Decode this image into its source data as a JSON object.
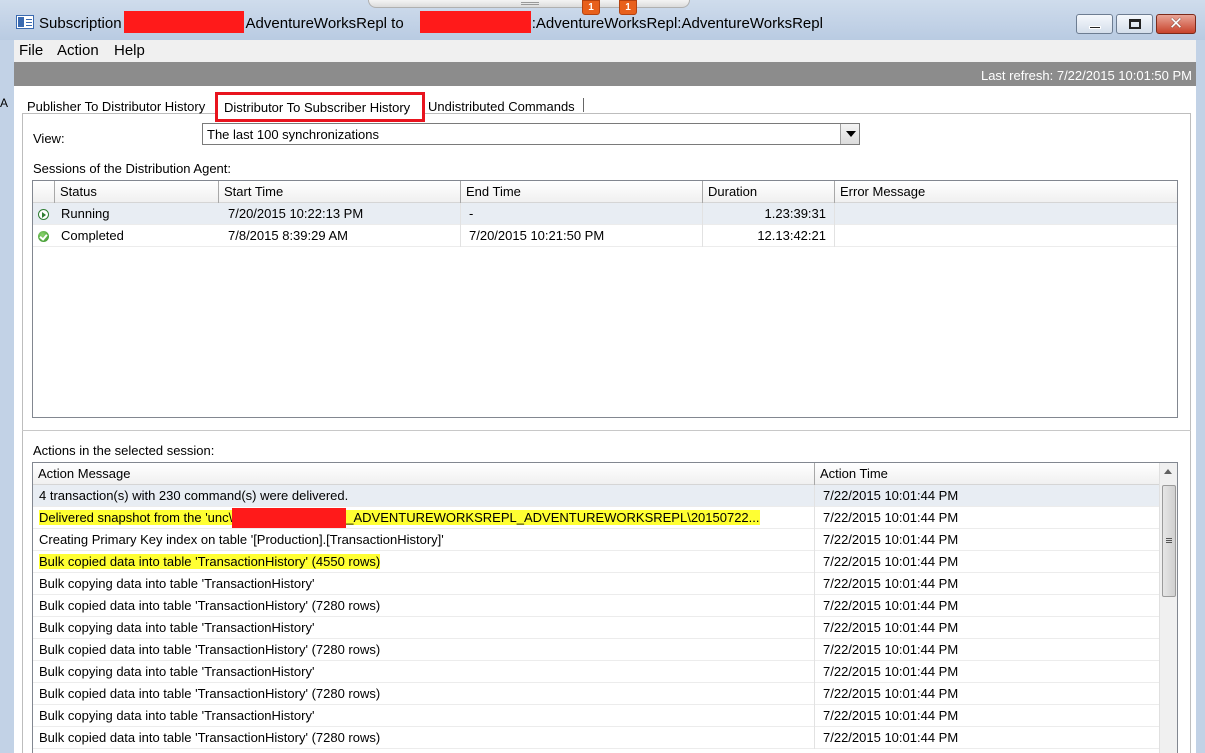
{
  "window": {
    "title_prefix": "Subscription",
    "title_middle": "AdventureWorksRepl to",
    "title_suffix": ":AdventureWorksRepl:AdventureWorksRepl",
    "notifications": [
      "1",
      "1"
    ],
    "close_glyph": "✕",
    "left_edge_mark": "A"
  },
  "menu": {
    "items": [
      "File",
      "Action",
      "Help"
    ]
  },
  "refresh": {
    "text": "Last refresh: 7/22/2015 10:01:50 PM"
  },
  "tabs": {
    "items": [
      "Publisher To Distributor History",
      "Distributor To Subscriber History",
      "Undistributed Commands"
    ],
    "active_index": 1
  },
  "view": {
    "label": "View:",
    "selected": "The last 100 synchronizations"
  },
  "sessions": {
    "label": "Sessions of the Distribution Agent:",
    "columns": [
      "Status",
      "Start Time",
      "End Time",
      "Duration",
      "Error Message"
    ],
    "rows": [
      {
        "status_icon": "running-icon",
        "status": "Running",
        "start": "7/20/2015 10:22:13 PM",
        "end": "-",
        "duration": "1.23:39:31",
        "error": ""
      },
      {
        "status_icon": "completed-icon",
        "status": "Completed",
        "start": "7/8/2015 8:39:29 AM",
        "end": "7/20/2015 10:21:50 PM",
        "duration": "12.13:42:21",
        "error": ""
      }
    ]
  },
  "actions": {
    "label": "Actions in the selected session:",
    "columns": [
      "Action Message",
      "Action Time"
    ],
    "snapshot_prefix": "Delivered snapshot from the 'unc\\",
    "snapshot_suffix": "_ADVENTUREWORKSREPL_ADVENTUREWORKSREPL\\20150722...",
    "rows": [
      {
        "message": "4 transaction(s) with 230 command(s) were delivered.",
        "time": "7/22/2015 10:01:44 PM"
      },
      {
        "message": "",
        "time": "7/22/2015 10:01:44 PM"
      },
      {
        "message": "Creating Primary Key index on table '[Production].[TransactionHistory]'",
        "time": "7/22/2015 10:01:44 PM"
      },
      {
        "message": "Bulk copied data into table 'TransactionHistory' (4550 rows)",
        "time": "7/22/2015 10:01:44 PM"
      },
      {
        "message": "Bulk copying data into table 'TransactionHistory'",
        "time": "7/22/2015 10:01:44 PM"
      },
      {
        "message": "Bulk copied data into table 'TransactionHistory' (7280 rows)",
        "time": "7/22/2015 10:01:44 PM"
      },
      {
        "message": "Bulk copying data into table 'TransactionHistory'",
        "time": "7/22/2015 10:01:44 PM"
      },
      {
        "message": "Bulk copied data into table 'TransactionHistory' (7280 rows)",
        "time": "7/22/2015 10:01:44 PM"
      },
      {
        "message": "Bulk copying data into table 'TransactionHistory'",
        "time": "7/22/2015 10:01:44 PM"
      },
      {
        "message": "Bulk copied data into table 'TransactionHistory' (7280 rows)",
        "time": "7/22/2015 10:01:44 PM"
      },
      {
        "message": "Bulk copying data into table 'TransactionHistory'",
        "time": "7/22/2015 10:01:44 PM"
      },
      {
        "message": "Bulk copied data into table 'TransactionHistory' (7280 rows)",
        "time": "7/22/2015 10:01:44 PM"
      }
    ]
  },
  "colors": {
    "highlight": "#ffff33",
    "redaction": "#ff1a1a",
    "active_tab_border": "#e8141e",
    "selected_row": "#e8edf3"
  }
}
